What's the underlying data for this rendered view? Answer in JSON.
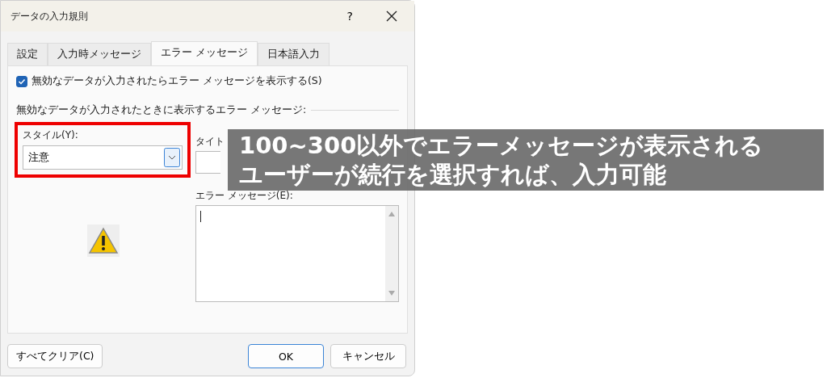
{
  "window": {
    "title": "データの入力規則",
    "help": "?"
  },
  "tabs": [
    {
      "label": "設定",
      "selected": false
    },
    {
      "label": "入力時メッセージ",
      "selected": false
    },
    {
      "label": "エラー メッセージ",
      "selected": true
    },
    {
      "label": "日本語入力",
      "selected": false
    }
  ],
  "show_error": {
    "label": "無効なデータが入力されたらエラー メッセージを表示する(S)",
    "checked": true
  },
  "section_heading": "無効なデータが入力されたときに表示するエラー メッセージ:",
  "style": {
    "label": "スタイル(Y):",
    "value": "注意",
    "kind": "warning",
    "highlighted": true
  },
  "title_field": {
    "label": "タイト"
  },
  "message_field": {
    "label": "エラー メッセージ(E):"
  },
  "buttons": [
    {
      "label": "すべてクリア(C)",
      "default": false
    },
    {
      "label": "OK",
      "default": true
    },
    {
      "label": "キャンセル",
      "default": false
    }
  ],
  "annotation": [
    "100~300以外でエラーメッセージが表示される",
    "ユーザーが続行を選択すれば、入力可能"
  ]
}
